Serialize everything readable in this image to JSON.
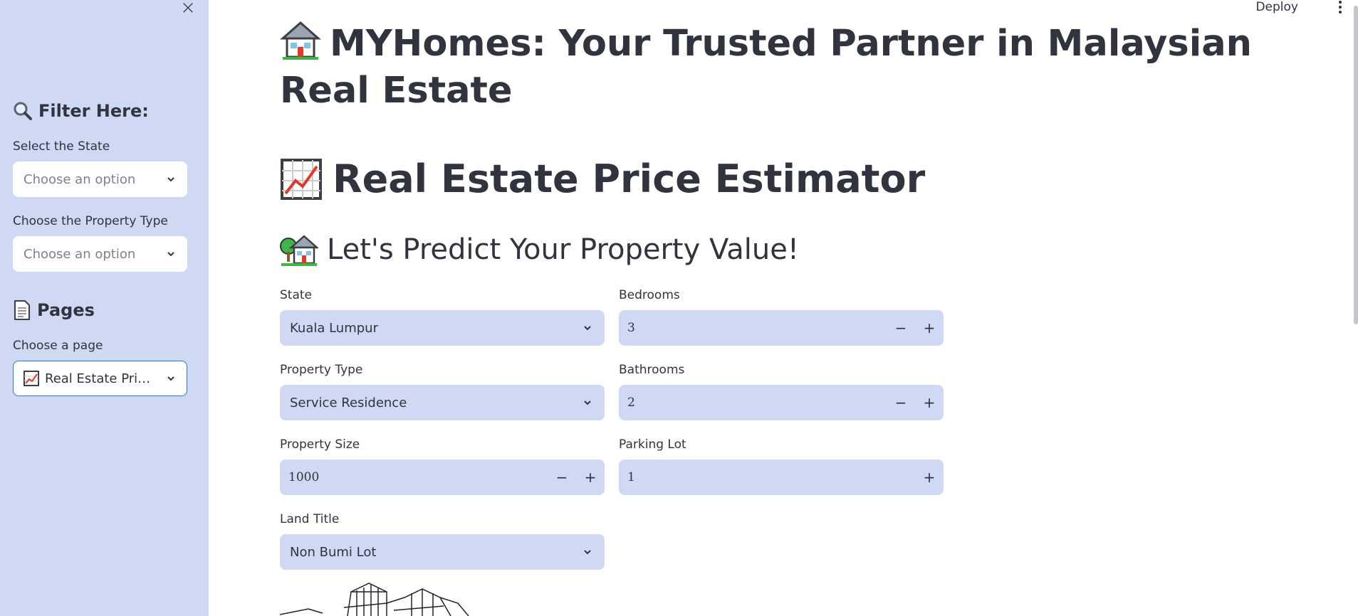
{
  "sidebar": {
    "filter_heading": "Filter Here:",
    "filter_icon": "magnifier-icon",
    "state_label": "Select the State",
    "state_placeholder": "Choose an option",
    "property_type_label": "Choose the Property Type",
    "property_type_placeholder": "Choose an option",
    "pages_heading": "Pages",
    "pages_icon": "page-icon",
    "page_label": "Choose a page",
    "page_selected": "Real Estate Pri…",
    "page_icon": "chart-increasing-icon",
    "close_icon": "close-icon"
  },
  "header": {
    "deploy_label": "Deploy",
    "menu_icon": "kebab-menu-icon"
  },
  "main": {
    "title": "MYHomes: Your Trusted Partner in Malaysian Real Estate",
    "title_icon": "house-icon",
    "estimator_heading": "Real Estate Price Estimator",
    "estimator_icon": "chart-increasing-icon",
    "predict_heading": "Let's Predict Your Property Value!",
    "predict_icon": "house-with-garden-icon",
    "form": {
      "state_label": "State",
      "state_value": "Kuala Lumpur",
      "property_type_label": "Property Type",
      "property_type_value": "Service Residence",
      "property_size_label": "Property Size",
      "property_size_value": "1000",
      "land_title_label": "Land Title",
      "land_title_value": "Non Bumi Lot",
      "bedrooms_label": "Bedrooms",
      "bedrooms_value": "3",
      "bathrooms_label": "Bathrooms",
      "bathrooms_value": "2",
      "parking_label": "Parking Lot",
      "parking_value": "1",
      "minus": "−",
      "plus": "+"
    }
  },
  "colors": {
    "sidebar_bg": "#cfd9f4",
    "input_bg": "#cfd9f4",
    "text": "#31333f",
    "focus_border": "#2f79c4"
  }
}
